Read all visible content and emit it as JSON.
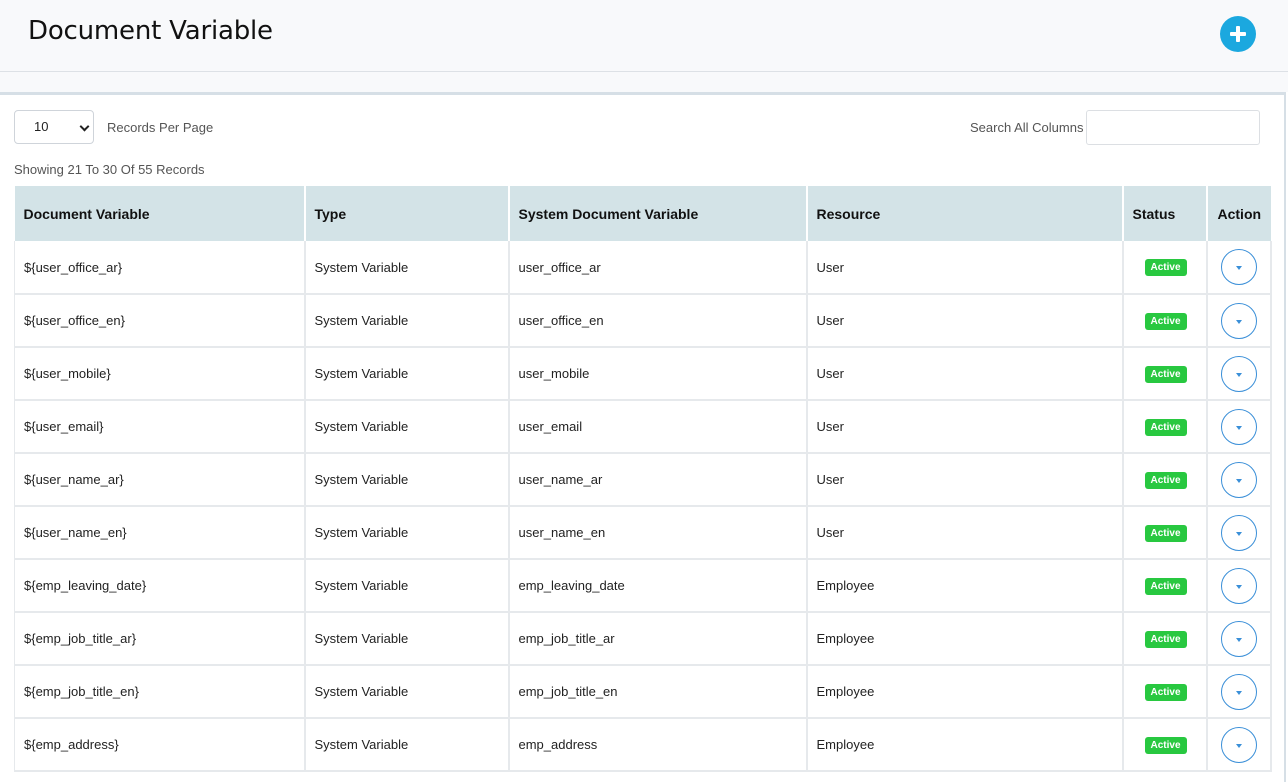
{
  "header": {
    "title": "Document Variable",
    "add_icon": "plus-circle-icon"
  },
  "controls": {
    "per_page_value": "10",
    "per_page_label": "Records Per Page",
    "search_label": "Search All Columns",
    "search_value": "",
    "showing_text": "Showing 21 To 30 Of 55 Records"
  },
  "table": {
    "columns": [
      "Document Variable",
      "Type",
      "System Document Variable",
      "Resource",
      "Status",
      "Action"
    ],
    "rows": [
      {
        "variable": "${user_office_ar}",
        "type": "System Variable",
        "system_variable": "user_office_ar",
        "resource": "User",
        "status": "Active"
      },
      {
        "variable": "${user_office_en}",
        "type": "System Variable",
        "system_variable": "user_office_en",
        "resource": "User",
        "status": "Active"
      },
      {
        "variable": "${user_mobile}",
        "type": "System Variable",
        "system_variable": "user_mobile",
        "resource": "User",
        "status": "Active"
      },
      {
        "variable": "${user_email}",
        "type": "System Variable",
        "system_variable": "user_email",
        "resource": "User",
        "status": "Active"
      },
      {
        "variable": "${user_name_ar}",
        "type": "System Variable",
        "system_variable": "user_name_ar",
        "resource": "User",
        "status": "Active"
      },
      {
        "variable": "${user_name_en}",
        "type": "System Variable",
        "system_variable": "user_name_en",
        "resource": "User",
        "status": "Active"
      },
      {
        "variable": "${emp_leaving_date}",
        "type": "System Variable",
        "system_variable": "emp_leaving_date",
        "resource": "Employee",
        "status": "Active"
      },
      {
        "variable": "${emp_job_title_ar}",
        "type": "System Variable",
        "system_variable": "emp_job_title_ar",
        "resource": "Employee",
        "status": "Active"
      },
      {
        "variable": "${emp_job_title_en}",
        "type": "System Variable",
        "system_variable": "emp_job_title_en",
        "resource": "Employee",
        "status": "Active"
      },
      {
        "variable": "${emp_address}",
        "type": "System Variable",
        "system_variable": "emp_address",
        "resource": "Employee",
        "status": "Active"
      }
    ]
  },
  "colors": {
    "accent": "#1ba8df",
    "header_bg": "#d3e3e7",
    "status_active": "#28c840",
    "action_border": "#3a8fd8"
  }
}
